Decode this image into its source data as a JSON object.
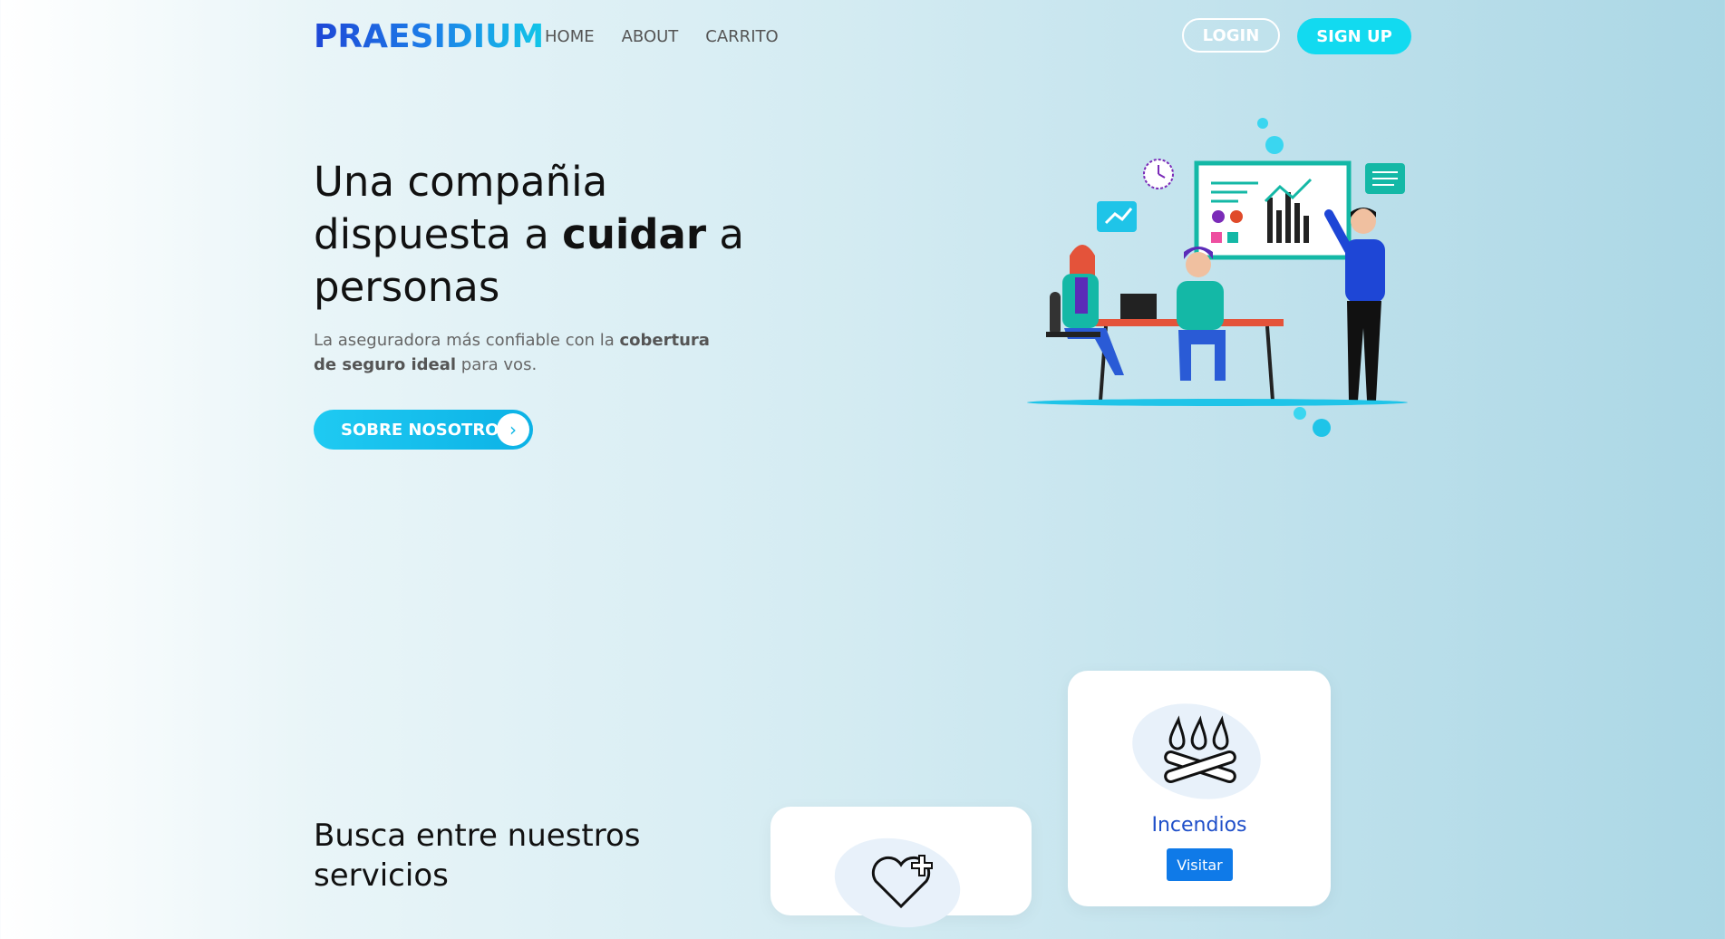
{
  "nav": {
    "logo": "PRAESIDIUM",
    "links": [
      "HOME",
      "ABOUT",
      "CARRITO"
    ],
    "login": "LOGIN",
    "signup": "SIGN UP"
  },
  "hero": {
    "title_line1": "Una compañia",
    "title_pre": "dispuesta a ",
    "title_bold": "cuidar",
    "title_post": " a",
    "title_line3": "personas",
    "sub_pre": "La aseguradora más confiable con la ",
    "sub_bold": "cobertura de seguro ideal",
    "sub_post": " para vos.",
    "cta": "SOBRE NOSOTROS",
    "cta_icon": "chevron-right-icon"
  },
  "services": {
    "title": "Busca entre nuestros servicios",
    "cards": [
      {
        "name": "",
        "icon": "heart-cross-icon"
      },
      {
        "name": "Incendios",
        "icon": "fire-icon",
        "button": "Visitar"
      }
    ]
  },
  "colors": {
    "accent": "#12daf0",
    "brand_blue": "#1e46d6",
    "link_blue": "#1f4fc9",
    "button_blue": "#0f7ae8"
  }
}
